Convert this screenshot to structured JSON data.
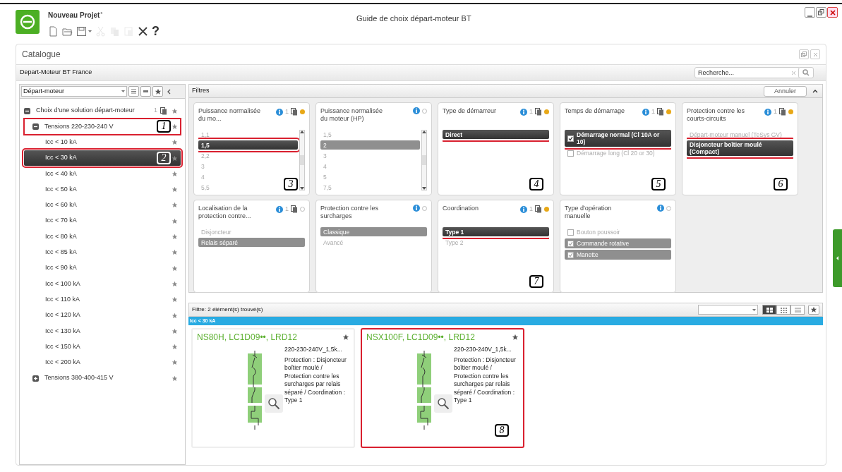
{
  "app": {
    "project": "Nouveau Projet",
    "modified_mark": "*",
    "title": "Guide de choix départ-moteur BT"
  },
  "toolbar": [
    {
      "kind": "new",
      "enabled": true
    },
    {
      "kind": "open",
      "enabled": true
    },
    {
      "kind": "save",
      "enabled": true
    },
    {
      "kind": "cut",
      "enabled": false
    },
    {
      "kind": "copy",
      "enabled": false
    },
    {
      "kind": "paste",
      "enabled": false
    },
    {
      "kind": "tools",
      "enabled": true
    },
    {
      "kind": "help",
      "enabled": true,
      "label": "?"
    }
  ],
  "catalogue": {
    "title": "Catalogue",
    "subtitle": "Depart-Moteur BT France",
    "search_placeholder": "Recherche..."
  },
  "sidebar": {
    "dropdown": "Départ-moteur",
    "tree": [
      {
        "label": "Choix d'une solution départ-moteur",
        "count": "1",
        "expanded": true,
        "selected": false,
        "children": [
          {
            "label": "Tensions 220-230-240 V",
            "expanded": true,
            "selected": false,
            "callout": "1",
            "children": [
              {
                "label": "Icc < 10 kA",
                "selected": false
              },
              {
                "label": "Icc < 30 kA",
                "selected": true,
                "callout": "2"
              },
              {
                "label": "Icc < 40 kA",
                "selected": false
              },
              {
                "label": "Icc < 50 kA",
                "selected": false
              },
              {
                "label": "Icc < 60 kA",
                "selected": false
              },
              {
                "label": "Icc < 70 kA",
                "selected": false
              },
              {
                "label": "Icc < 80 kA",
                "selected": false
              },
              {
                "label": "Icc < 85 kA",
                "selected": false
              },
              {
                "label": "Icc < 90 kA",
                "selected": false
              },
              {
                "label": "Icc < 100 kA",
                "selected": false
              },
              {
                "label": "Icc < 110 kA",
                "selected": false
              },
              {
                "label": "Icc < 120 kA",
                "selected": false
              },
              {
                "label": "Icc < 130 kA",
                "selected": false
              },
              {
                "label": "Icc < 150 kA",
                "selected": false
              },
              {
                "label": "Icc < 200 kA",
                "selected": false
              }
            ]
          },
          {
            "label": "Tensions 380-400-415 V",
            "expanded": false,
            "selected": false
          }
        ]
      }
    ]
  },
  "filters": {
    "title": "Filtres",
    "cancel": "Annuler",
    "cards": [
      {
        "title": "Puissance normalisée du mo...",
        "count": "1",
        "active": true,
        "kind": "list",
        "scroll": true,
        "callout": "3",
        "options": [
          {
            "label": "1,1",
            "selected": false,
            "enabled": false,
            "highlighted": false
          },
          {
            "label": "1,5",
            "selected": true,
            "enabled": true,
            "highlighted": true
          },
          {
            "label": "2,2",
            "selected": false,
            "enabled": false,
            "highlighted": false
          },
          {
            "label": "3",
            "selected": false,
            "enabled": false,
            "highlighted": false
          },
          {
            "label": "4",
            "selected": false,
            "enabled": false,
            "highlighted": false
          },
          {
            "label": "5,5",
            "selected": false,
            "enabled": false,
            "highlighted": false
          }
        ]
      },
      {
        "title": "Puissance normalisée du moteur (HP)",
        "active": false,
        "kind": "list",
        "scroll": true,
        "options": [
          {
            "label": "1,5",
            "selected": false,
            "enabled": false,
            "highlighted": false
          },
          {
            "label": "2",
            "selected": true,
            "enabled": false,
            "highlighted": false
          },
          {
            "label": "3",
            "selected": false,
            "enabled": false,
            "highlighted": false
          },
          {
            "label": "4",
            "selected": false,
            "enabled": false,
            "highlighted": false
          },
          {
            "label": "5",
            "selected": false,
            "enabled": false,
            "highlighted": false
          },
          {
            "label": "7,5",
            "selected": false,
            "enabled": false,
            "highlighted": false
          }
        ]
      },
      {
        "title": "Type de démarreur",
        "count": "1",
        "active": true,
        "kind": "list",
        "scroll": false,
        "callout": "4",
        "options": [
          {
            "label": "Direct",
            "selected": true,
            "enabled": true,
            "highlighted": true
          }
        ]
      },
      {
        "title": "Temps de démarrage",
        "count": "1",
        "active": true,
        "kind": "checkbox",
        "scroll": false,
        "callout": "5",
        "options": [
          {
            "label": "Démarrage normal (Cl 10A or 10)",
            "selected": true,
            "checked": true,
            "enabled": true,
            "highlighted": true
          },
          {
            "label": "Démarrage long (Cl 20 or 30)",
            "selected": false,
            "checked": false,
            "enabled": false,
            "highlighted": false
          }
        ]
      },
      {
        "title": "Protection contre les courts-circuits",
        "count": "1",
        "active": true,
        "kind": "list",
        "scroll": false,
        "callout": "6",
        "options": [
          {
            "label": "Départ-moteur manuel (TeSys GV)",
            "selected": false,
            "enabled": false,
            "highlighted": false
          },
          {
            "label": "Disjoncteur boîtier moulé (Compact)",
            "selected": true,
            "enabled": true,
            "highlighted": true
          }
        ]
      },
      {
        "title": "Localisation de la protection contre...",
        "count": "1",
        "active": false,
        "kind": "list",
        "scroll": false,
        "options": [
          {
            "label": "Disjoncteur",
            "selected": false,
            "enabled": false,
            "highlighted": false
          },
          {
            "label": "Relais séparé",
            "selected": true,
            "enabled": false,
            "highlighted": false
          }
        ]
      },
      {
        "title": "Protection contre les surcharges",
        "active": false,
        "kind": "list",
        "scroll": false,
        "options": [
          {
            "label": "Classique",
            "selected": true,
            "enabled": false,
            "highlighted": false
          },
          {
            "label": "Avancé",
            "selected": false,
            "enabled": false,
            "highlighted": false
          }
        ]
      },
      {
        "title": "Coordination",
        "count": "1",
        "active": true,
        "kind": "list",
        "scroll": false,
        "callout": "7",
        "options": [
          {
            "label": "Type 1",
            "selected": true,
            "enabled": true,
            "highlighted": true
          },
          {
            "label": "Type 2",
            "selected": false,
            "enabled": false,
            "highlighted": false
          }
        ]
      },
      {
        "title": "Type d'opération manuelle",
        "active": false,
        "kind": "checkbox",
        "scroll": false,
        "options": [
          {
            "label": "Bouton poussoir",
            "selected": false,
            "checked": false,
            "enabled": false,
            "highlighted": false
          },
          {
            "label": "Commande rotative",
            "selected": true,
            "checked": true,
            "enabled": false,
            "highlighted": false
          },
          {
            "label": "Manette",
            "selected": true,
            "checked": true,
            "enabled": false,
            "highlighted": false
          }
        ]
      }
    ]
  },
  "results": {
    "summary": "Filtre: 2 élément(s) trouvé(s)",
    "group": "Icc < 30 kA",
    "view": [
      {
        "kind": "large",
        "selected": true
      },
      {
        "kind": "small",
        "selected": false
      },
      {
        "kind": "list",
        "selected": false
      }
    ],
    "items": [
      {
        "title": "NS80H, LC1D09••, LRD12",
        "subtitle": "220-230-240V_1,5k...",
        "description": "Protection : Disjoncteur boîtier moulé / Protection contre les surcharges par relais séparé / Coordination : Type 1",
        "highlighted": false
      },
      {
        "title": "NSX100F, LC1D09••, LRD12",
        "subtitle": "220-230-240V_1,5k...",
        "description": "Protection : Disjoncteur boîtier moulé / Protection contre les surcharges par relais séparé / Coordination : Type 1",
        "highlighted": true,
        "callout": "8"
      }
    ]
  }
}
